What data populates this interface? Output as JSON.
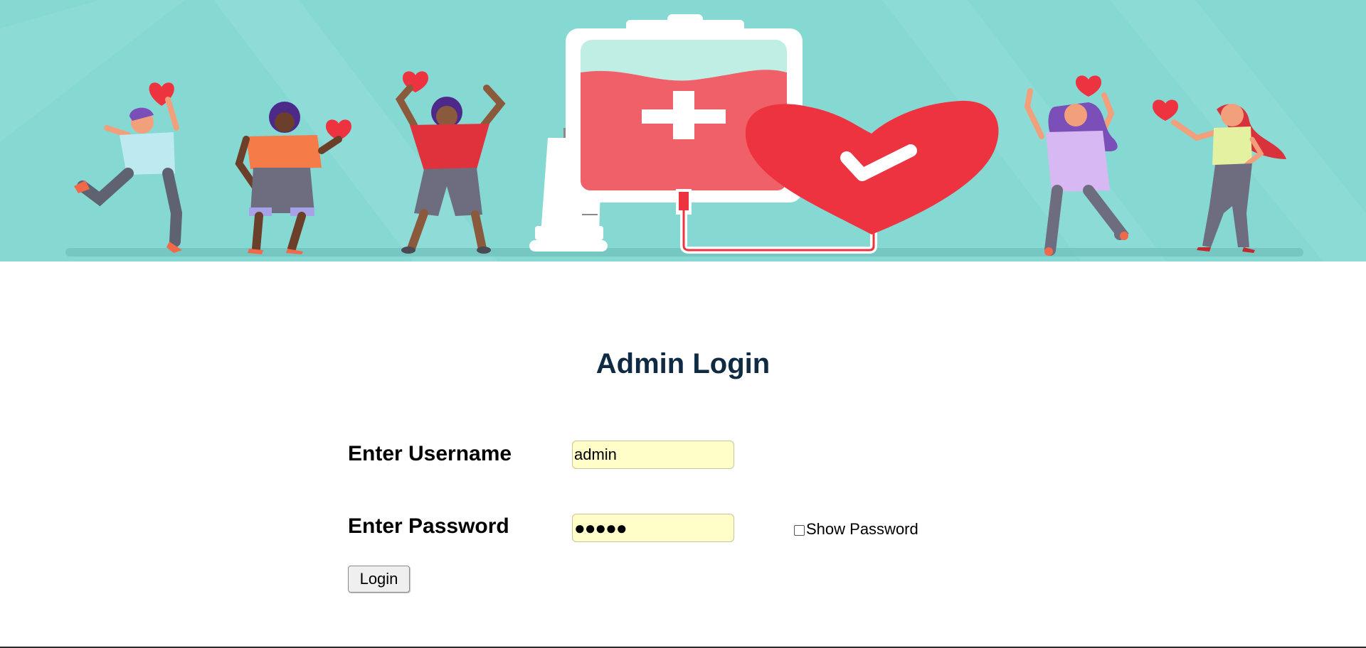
{
  "page": {
    "title": "Admin Login",
    "username_label": "Enter Username",
    "username_value": "admin",
    "password_label": "Enter Password",
    "password_masked": "●●●●●",
    "show_password_label": "Show Password",
    "show_password_checked": false,
    "login_label": "Login"
  },
  "banner": {
    "icons": [
      "blood-bag-icon",
      "syringe-icon",
      "heart-check-icon",
      "person-with-heart-icon"
    ],
    "colors": {
      "background": "#86d8d3",
      "heart": "#ee3340",
      "blood": "#f06068"
    }
  }
}
